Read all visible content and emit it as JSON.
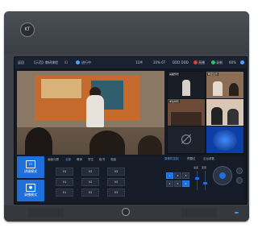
{
  "device": {
    "logo_text": "KT"
  },
  "topbar": {
    "back_label": "返回",
    "course_label": "【示范】教研课程",
    "course_id": "ID",
    "course_id_value": "",
    "status_label": "进行中",
    "info": [
      "11M",
      "20% 6T",
      "DDD DDD"
    ],
    "live_label": "直播",
    "rec_label": "录制",
    "net_label": "60%",
    "colors": {
      "accent": "#4aa3ff",
      "live": "#e23b3b",
      "rec": "#28c46a"
    }
  },
  "thumbs": [
    {
      "label": "画面预览"
    },
    {
      "label": "教室全景"
    },
    {
      "label": "学生特写"
    },
    {
      "label": ""
    },
    {
      "label": ""
    },
    {
      "label": ""
    }
  ],
  "modes": [
    {
      "label": "讲课模式",
      "icon": "monitor-icon"
    },
    {
      "label": "录播模式",
      "icon": "camera-icon"
    }
  ],
  "tabs": [
    "画面分屏",
    "全部",
    "教师",
    "学生",
    "板书",
    "电脑"
  ],
  "grid": [
    "V1",
    "V2",
    "V3",
    "V1",
    "V2",
    "V3",
    "V1",
    "V2",
    "V3"
  ],
  "ptz": {
    "tabs": [
      "摄像机控制",
      "预置位",
      "云台参数"
    ],
    "keys": [
      "1",
      "2",
      "3",
      "4",
      "5",
      "6"
    ],
    "speed_label": "速度",
    "zoom_label": "变倍"
  }
}
